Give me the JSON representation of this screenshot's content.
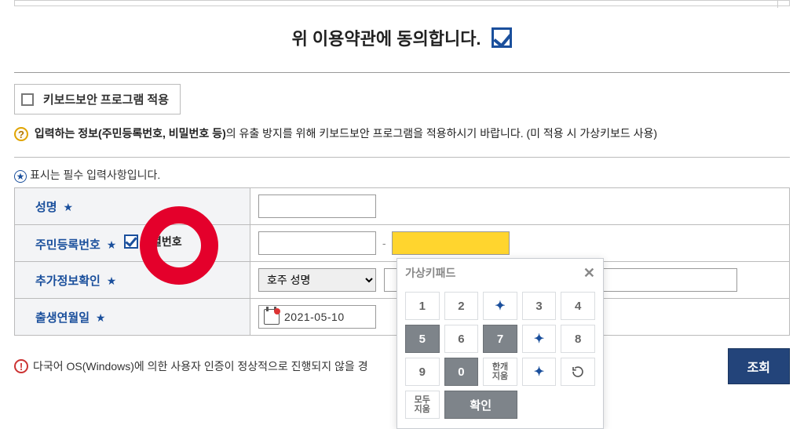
{
  "agree": {
    "text": "위 이용약관에 동의합니다."
  },
  "keyboard_sec": {
    "button_label": "키보드보안 프로그램 적용",
    "help_bold": "입력하는 정보(주민등록번호, 비밀번호 등)",
    "help_rest": "의 유출 방지를 위해 키보드보안 프로그램을 적용하시기 바랍니다. (미 적용 시 가상키보드 사용)"
  },
  "required_note": "표시는 필수 입력사항입니다.",
  "form": {
    "name": {
      "label": "성명"
    },
    "rrn": {
      "label": "주민등록번호",
      "id_check_label": "식별번호"
    },
    "extra": {
      "label": "추가정보확인",
      "select_value": "호주 성명"
    },
    "dob": {
      "label": "출생연월일",
      "date_value": "2021-05-10"
    }
  },
  "bottom": {
    "msg": "다국어 OS(Windows)에 의한 사용자 인증이 정상적으로 진행되지 않을 경",
    "lookup": "조회"
  },
  "keypad": {
    "title": "가상키패드",
    "keys_row1": [
      "1",
      "2",
      "bird",
      "3",
      "4",
      "5"
    ],
    "keys_row2": [
      "6",
      "7",
      "bird",
      "8",
      "9",
      "0"
    ],
    "clear_one": "한개\n지움",
    "clear_all": "모두\n지움",
    "confirm": "확인"
  }
}
